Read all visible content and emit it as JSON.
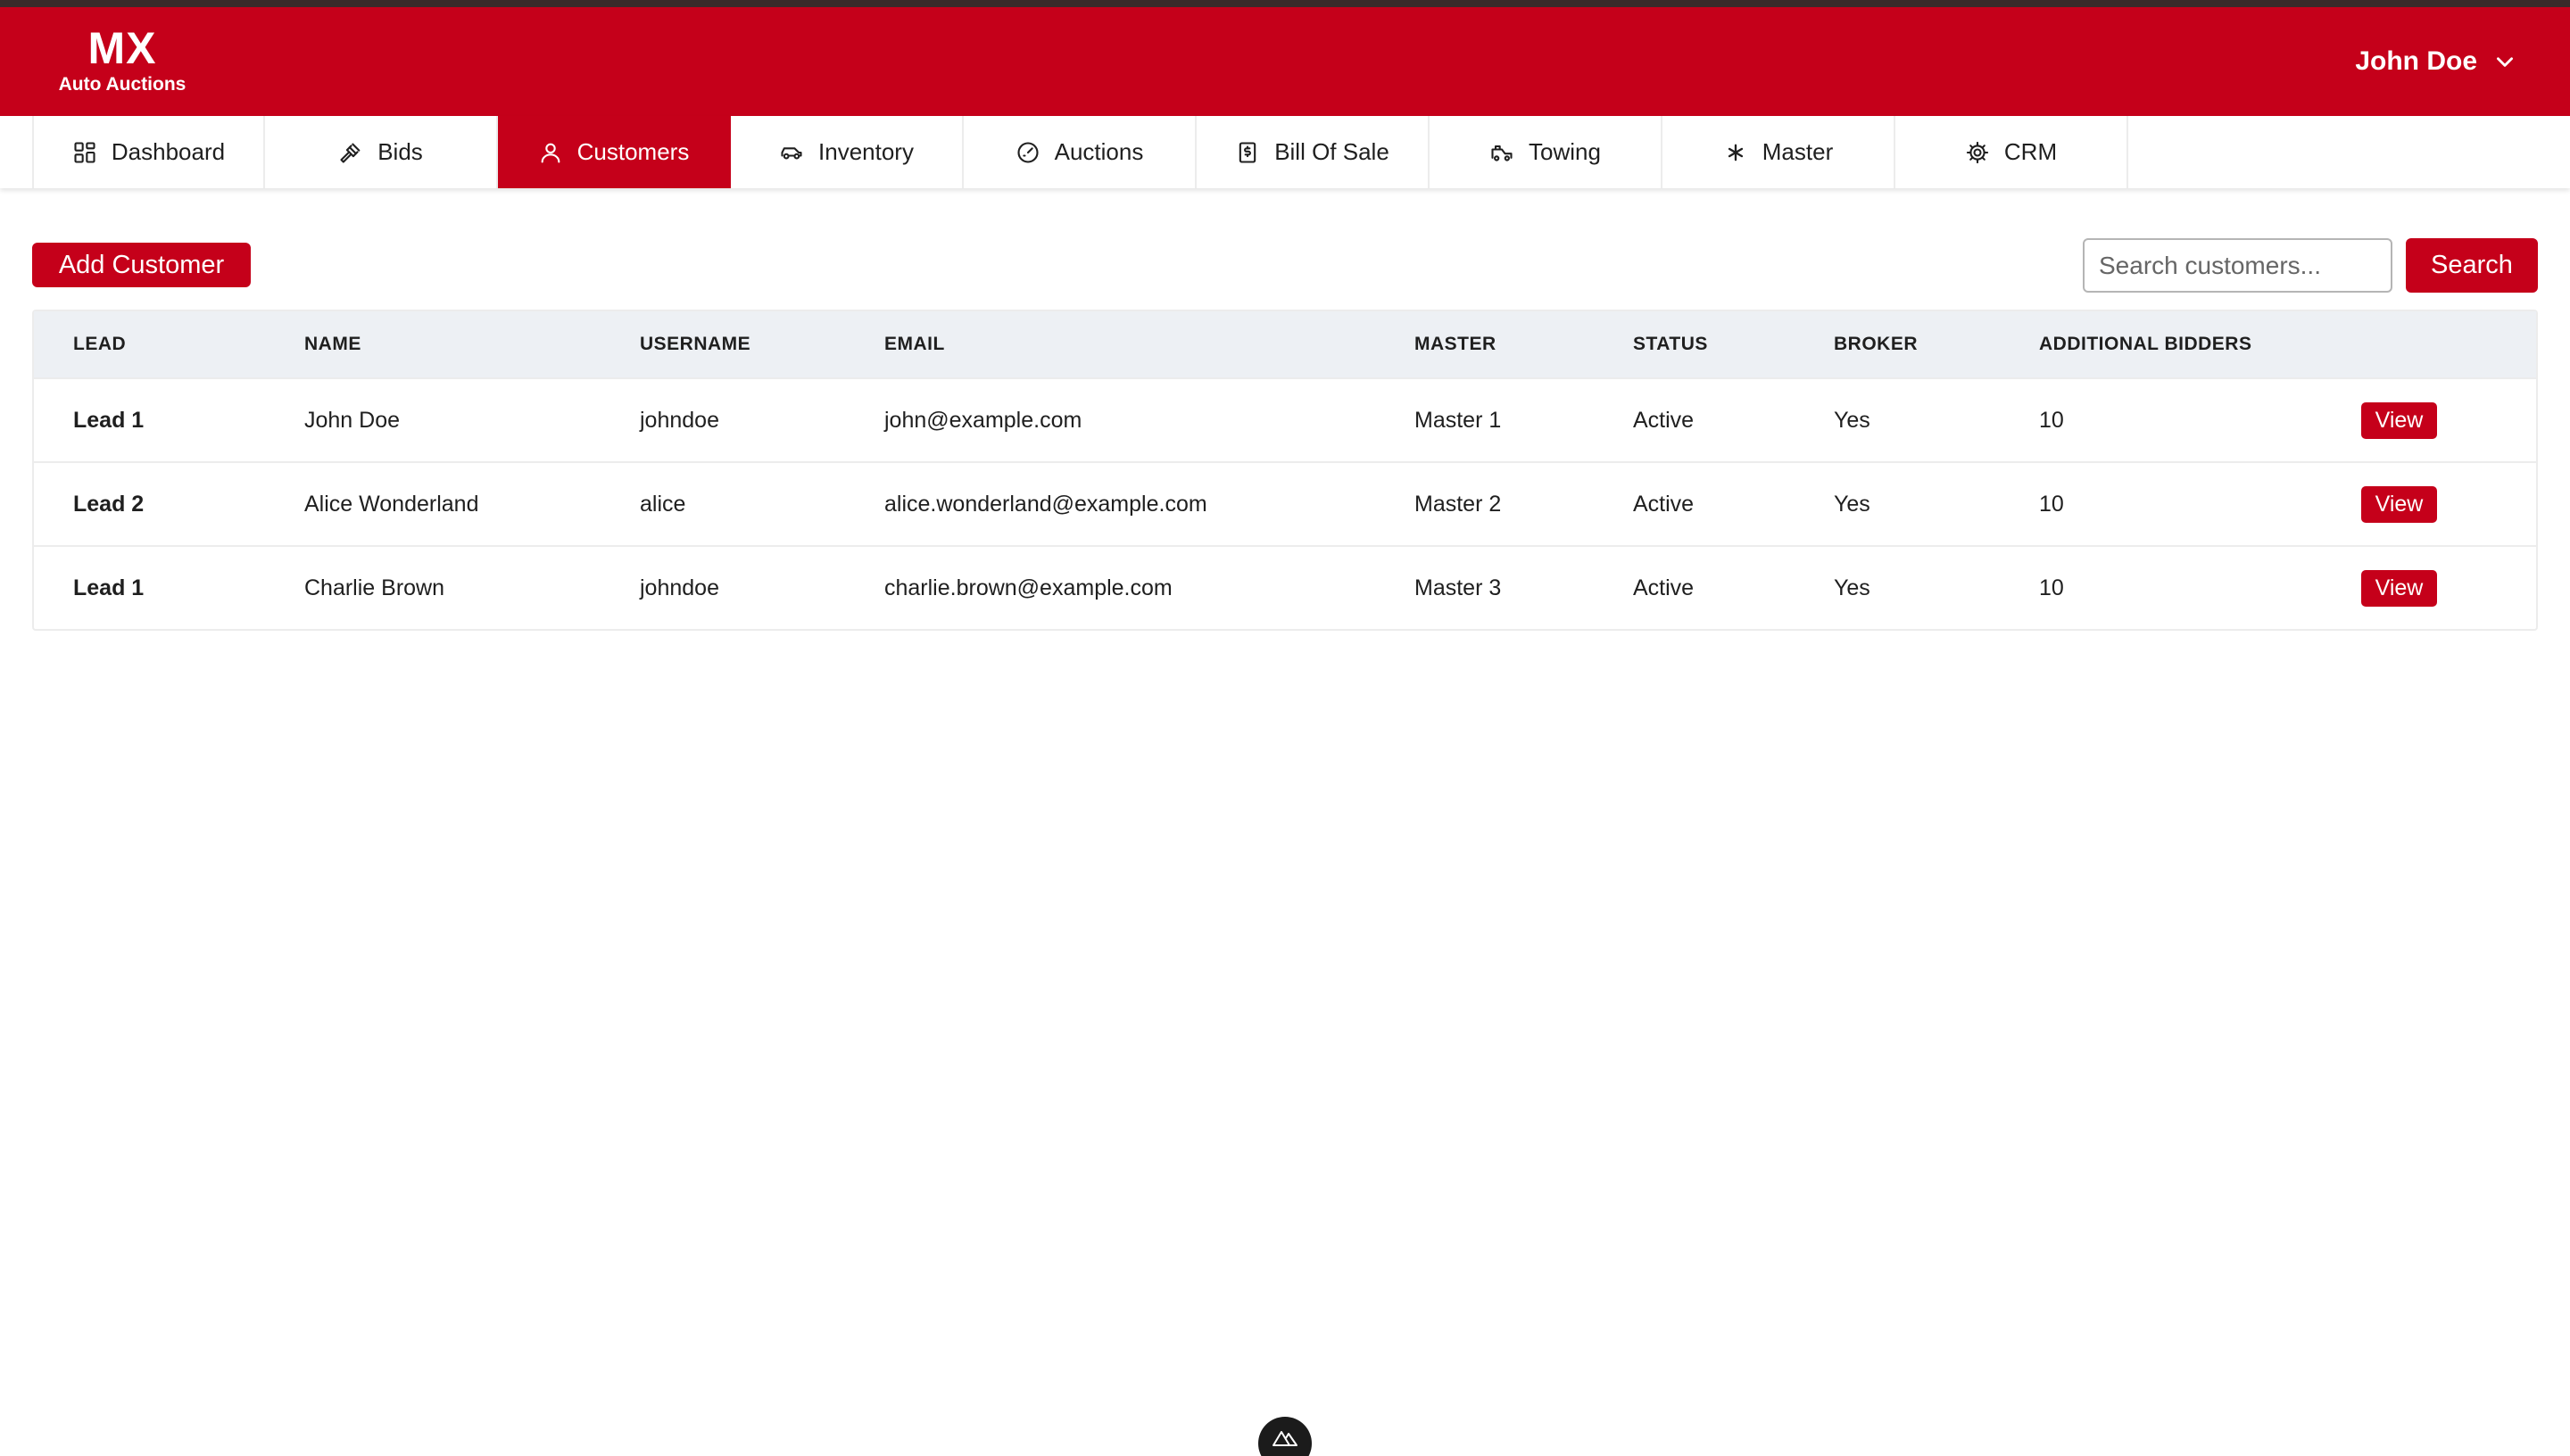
{
  "header": {
    "logo_title": "MX",
    "logo_subtitle": "Auto Auctions",
    "user_name": "John Doe"
  },
  "nav": {
    "tabs": [
      {
        "label": "Dashboard",
        "icon": "grid-icon",
        "active": false
      },
      {
        "label": "Bids",
        "icon": "gavel-icon",
        "active": false
      },
      {
        "label": "Customers",
        "icon": "user-icon",
        "active": true
      },
      {
        "label": "Inventory",
        "icon": "car-icon",
        "active": false
      },
      {
        "label": "Auctions",
        "icon": "gauge-icon",
        "active": false
      },
      {
        "label": "Bill Of Sale",
        "icon": "receipt-icon",
        "active": false
      },
      {
        "label": "Towing",
        "icon": "truck-icon",
        "active": false
      },
      {
        "label": "Master",
        "icon": "asterisk-icon",
        "active": false
      },
      {
        "label": "CRM",
        "icon": "gear-icon",
        "active": false
      }
    ]
  },
  "toolbar": {
    "add_label": "Add Customer",
    "search_placeholder": "Search customers...",
    "search_label": "Search"
  },
  "table": {
    "columns": [
      "LEAD",
      "NAME",
      "USERNAME",
      "EMAIL",
      "MASTER",
      "STATUS",
      "BROKER",
      "ADDITIONAL BIDDERS"
    ],
    "rows": [
      {
        "lead": "Lead 1",
        "name": "John Doe",
        "username": "johndoe",
        "email": "john@example.com",
        "master": "Master 1",
        "status": "Active",
        "broker": "Yes",
        "additional_bidders": "10",
        "action": "View"
      },
      {
        "lead": "Lead 2",
        "name": "Alice Wonderland",
        "username": "alice",
        "email": "alice.wonderland@example.com",
        "master": "Master 2",
        "status": "Active",
        "broker": "Yes",
        "additional_bidders": "10",
        "action": "View"
      },
      {
        "lead": "Lead 1",
        "name": "Charlie Brown",
        "username": "johndoe",
        "email": "charlie.brown@example.com",
        "master": "Master 3",
        "status": "Active",
        "broker": "Yes",
        "additional_bidders": "10",
        "action": "View"
      }
    ]
  },
  "colors": {
    "brand_red": "#c5001a",
    "table_header_bg": "#edf0f4"
  }
}
